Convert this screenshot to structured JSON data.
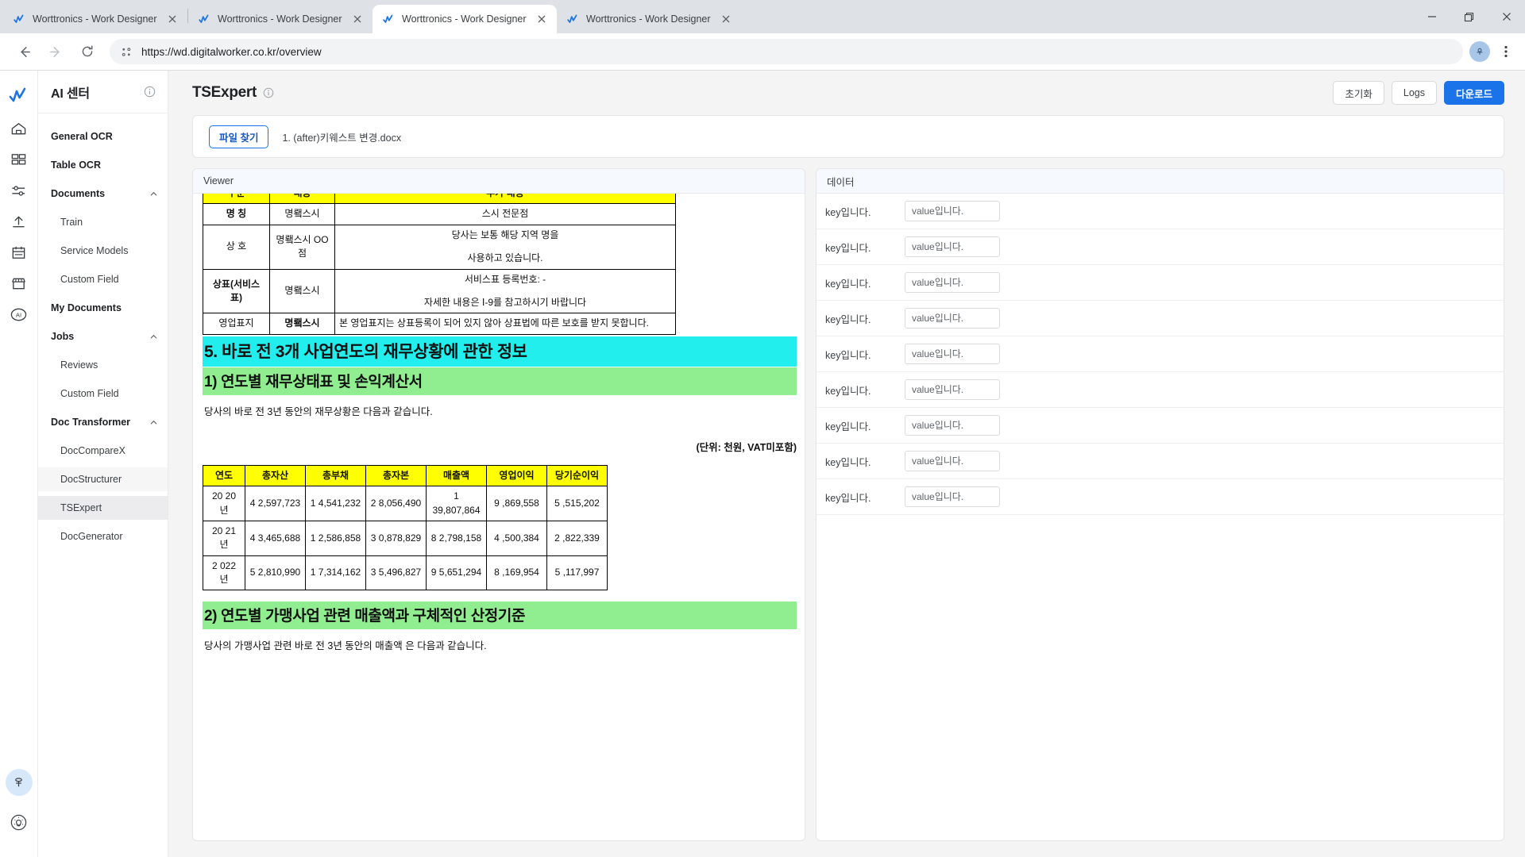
{
  "browser": {
    "tabs": [
      {
        "title": "Worttronics - Work Designer",
        "active": false
      },
      {
        "title": "Worttronics - Work Designer",
        "active": false
      },
      {
        "title": "Worttronics - Work Designer",
        "active": true
      },
      {
        "title": "Worttronics - Work Designer",
        "active": false
      }
    ],
    "url": "https://wd.digitalworker.co.kr/overview",
    "close_glyph": "✕",
    "minimize_glyph": "—",
    "maximize_glyph": "❐",
    "window_close_glyph": "✕",
    "back_glyph": "←",
    "forward_glyph": "→",
    "reload_glyph": "⟳",
    "kebab_glyph": "⋮"
  },
  "rail": {
    "items": [
      {
        "name": "logo-icon",
        "label": "Worttronics"
      },
      {
        "name": "home-icon",
        "label": "Home"
      },
      {
        "name": "dashboard-icon",
        "label": "Dashboard"
      },
      {
        "name": "settings-sliders-icon",
        "label": "Settings"
      },
      {
        "name": "upload-icon",
        "label": "Upload"
      },
      {
        "name": "calendar-icon",
        "label": "Calendar"
      },
      {
        "name": "store-icon",
        "label": "Store"
      },
      {
        "name": "ai-icon",
        "label": "AI",
        "active": true
      }
    ],
    "bottom": [
      {
        "name": "pin-icon",
        "label": "Pin",
        "active": true
      },
      {
        "name": "lightbulb-icon",
        "label": "Tips"
      }
    ]
  },
  "sidebar": {
    "title": "AI 센터",
    "items": [
      {
        "label": "General OCR",
        "type": "group",
        "state": ""
      },
      {
        "label": "Table OCR",
        "type": "group",
        "state": ""
      },
      {
        "label": "Documents",
        "type": "group",
        "state": "",
        "expandable": true
      },
      {
        "label": "Train",
        "type": "child",
        "state": ""
      },
      {
        "label": "Service Models",
        "type": "child",
        "state": ""
      },
      {
        "label": "Custom Field",
        "type": "child",
        "state": ""
      },
      {
        "label": "My Documents",
        "type": "group",
        "state": ""
      },
      {
        "label": "Jobs",
        "type": "group",
        "state": "",
        "expandable": true
      },
      {
        "label": "Reviews",
        "type": "child",
        "state": ""
      },
      {
        "label": "Custom Field",
        "type": "child",
        "state": ""
      },
      {
        "label": "Doc Transformer",
        "type": "group",
        "state": "",
        "expandable": true
      },
      {
        "label": "DocCompareX",
        "type": "child",
        "state": ""
      },
      {
        "label": "DocStructurer",
        "type": "child",
        "state": "hovered"
      },
      {
        "label": "TSExpert",
        "type": "child",
        "state": "selected"
      },
      {
        "label": "DocGenerator",
        "type": "child",
        "state": ""
      }
    ]
  },
  "header": {
    "title": "TSExpert",
    "buttons": {
      "reset": "초기화",
      "logs": "Logs",
      "download": "다운로드"
    },
    "accent_color": "#1a73e8"
  },
  "file_bar": {
    "browse_button": "파일 찾기",
    "file_name": "1. (after)키웨스트 변경.docx"
  },
  "viewer": {
    "panel_title": "Viewer",
    "info_table": {
      "header": [
        "구분",
        "내용",
        "추가 내용"
      ],
      "rows": [
        {
          "c1": "명 칭",
          "c1_bold": true,
          "c2": "명뢬스시",
          "c3_lines": [
            "스시 전문점"
          ]
        },
        {
          "c1": "상 호",
          "c1_bold": false,
          "c2": "명뢬스시 OO점",
          "c3_lines": [
            "당사는 보통 해당 지역 명을",
            "사용하고 있습니다."
          ]
        },
        {
          "c1": "상표(서비스표)",
          "c1_bold": true,
          "c2": "명뢬스시",
          "c3_lines": [
            "서비스표 등록번호: -",
            "자세한 내용은 Ⅰ-9를 참고하시기 바랍니다"
          ]
        },
        {
          "c1": "영업표지",
          "c1_bold": false,
          "c2": "명뢬스시",
          "c2_bold": true,
          "c3_lines": [
            "본 영업표지는 상표등록이 되어 있지 않아 상표법에 따른 보호를 받지 못합니다."
          ],
          "c3_align": "left"
        }
      ]
    },
    "heading_cyan": "5. 바로 전 3개 사업연도의 재무상황에 관한 정보",
    "heading_green_1": "1) 연도별 재무상태표 및 손익계산서",
    "para_1": "당사의  바로 전 3년 동안의 재무상황은 다음과 같습니다.",
    "unit_note": "(단위: 천원, VAT미포함)",
    "finance_table": {
      "header": [
        "연도",
        "총자산",
        "총부채",
        "총자본",
        "매출액",
        "영업이익",
        "당기순이익"
      ],
      "rows": [
        [
          "20 20 년",
          "4 2,597,723",
          "1 4,541,232",
          "2 8,056,490",
          "1 39,807,864",
          "9 ,869,558",
          "5 ,515,202"
        ],
        [
          "20 21 년",
          "4 3,465,688",
          "1 2,586,858",
          "3 0,878,829",
          "8 2,798,158",
          "4 ,500,384",
          "2 ,822,339"
        ],
        [
          "2 022 년",
          "5 2,810,990",
          "1 7,314,162",
          "3 5,496,827",
          "9 5,651,294",
          "8 ,169,954",
          "5 ,117,997"
        ]
      ]
    },
    "heading_green_2": "2) 연도별 가맹사업 관련 매출액과 구체적인 산정기준",
    "para_2": "당사의 가맹사업 관련  바로 전  3년 동안의  매출액 은 다음과 같습니다.",
    "highlight_colors": {
      "cyan": "#22eeee",
      "green": "#90ee90",
      "yellow": "#ffff00"
    }
  },
  "data_panel": {
    "panel_title": "데이터",
    "rows": [
      {
        "key": "key입니다.",
        "placeholder": "value입니다."
      },
      {
        "key": "key입니다.",
        "placeholder": "value입니다."
      },
      {
        "key": "key입니다.",
        "placeholder": "value입니다."
      },
      {
        "key": "key입니다.",
        "placeholder": "value입니다."
      },
      {
        "key": "key입니다.",
        "placeholder": "value입니다."
      },
      {
        "key": "key입니다.",
        "placeholder": "value입니다."
      },
      {
        "key": "key입니다.",
        "placeholder": "value입니다."
      },
      {
        "key": "key입니다.",
        "placeholder": "value입니다."
      },
      {
        "key": "key입니다.",
        "placeholder": "value입니다."
      }
    ]
  }
}
